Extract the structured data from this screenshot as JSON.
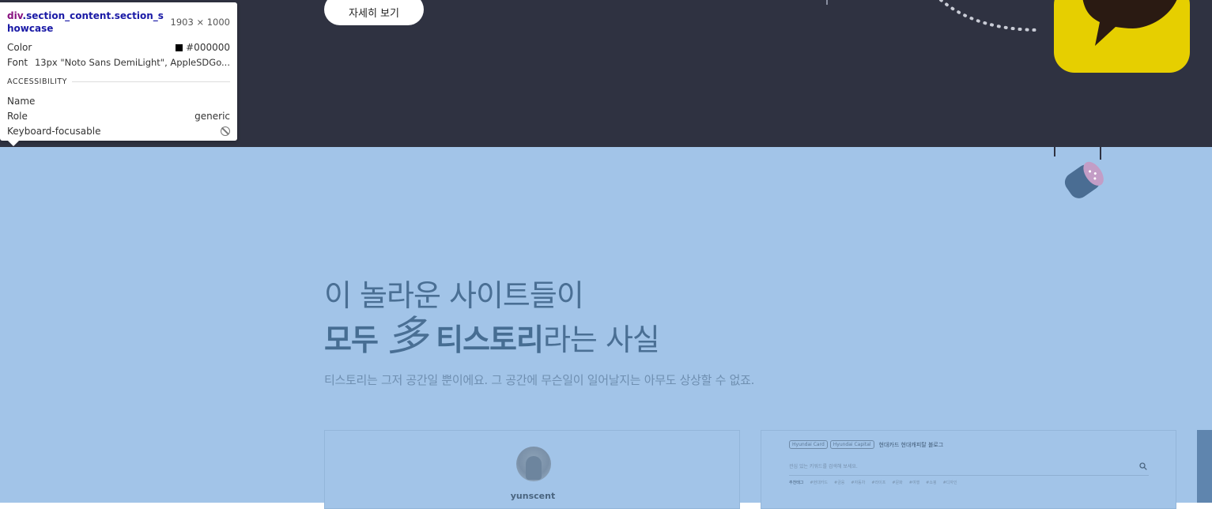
{
  "showcase": {
    "more_button": "자세히 보기",
    "heading_line1": "이 놀라운 사이트들이",
    "heading_bold1": "모두",
    "heading_multi": "多",
    "heading_bold2": "티스토리",
    "heading_rest": "라는 사실",
    "subtitle": "티스토리는 그저 공간일 뿐이에요. 그 공간에 무슨일이 일어날지는 아무도 상상할 수 없죠."
  },
  "cards": {
    "left": {
      "user": "yunscent"
    },
    "right": {
      "tags": [
        "Hyundai Card",
        "Hyundai Capital"
      ],
      "title": "현대카드 현대캐피탈 블로그",
      "search_placeholder": "관심 있는 키워드를 검색해 보세요.",
      "topic_tags": [
        "추천태그",
        "#현대카드",
        "#금융",
        "#자동차",
        "#라이프",
        "#문화",
        "#여행",
        "#쇼핑",
        "#디자인"
      ]
    }
  },
  "inspector": {
    "element": "div",
    "classes": ".section_content.section_showcase",
    "size": "1903 × 1000",
    "color_label": "Color",
    "color_value": "#000000",
    "font_label": "Font",
    "font_value": "13px \"Noto Sans DemiLight\", AppleSDGo...",
    "section_title": "ACCESSIBILITY",
    "name_label": "Name",
    "name_value": "",
    "role_label": "Role",
    "role_value": "generic",
    "focus_label": "Keyboard-focusable"
  },
  "colors": {
    "dark_band": "#2f3241",
    "blue_band": "#a2c4e8",
    "kakao_yellow": "#e6cf00",
    "heading_text": "#4a6f94"
  }
}
